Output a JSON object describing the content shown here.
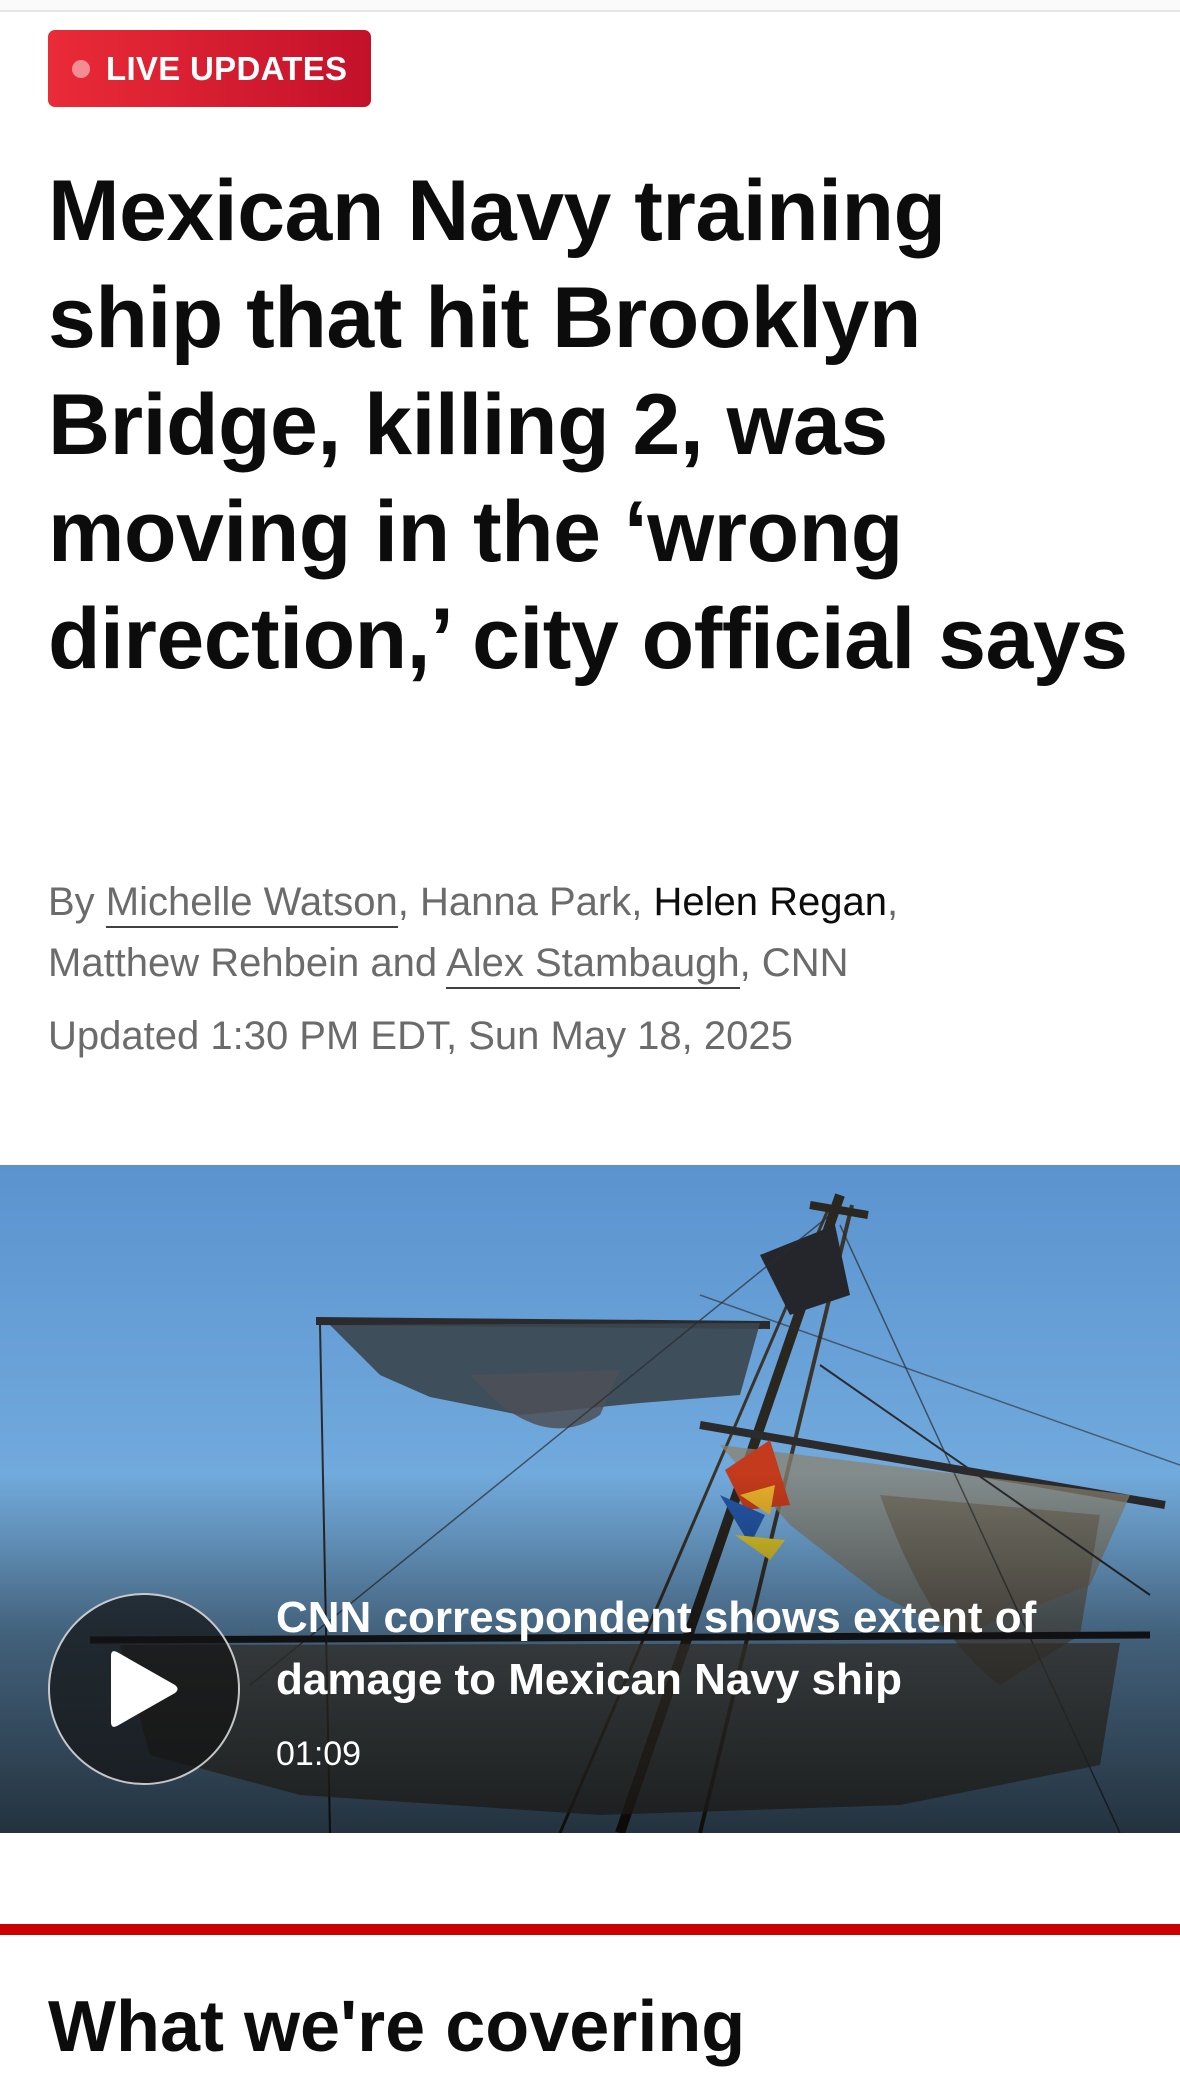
{
  "badge": {
    "label": "LIVE UPDATES",
    "color": "#cc0000"
  },
  "article": {
    "headline": "Mexican Navy training ship that hit Brooklyn Bridge, killing 2, was moving in the ‘wrong direction,’ city official says",
    "byline": {
      "prefix": "By ",
      "authors": [
        "Michelle Watson",
        "Hanna Park",
        "Helen Regan",
        "Matthew Rehbein",
        "Alex Stambaugh"
      ],
      "sep1": ", ",
      "sep2": ", ",
      "sep3": ",",
      "sep4": " and ",
      "suffix": ", CNN"
    },
    "updated": "Updated 1:30 PM EDT, Sun May 18, 2025"
  },
  "video": {
    "title": "CNN correspondent shows extent of damage to Mexican Navy ship",
    "duration": "01:09",
    "play_icon": "play-icon"
  },
  "section": {
    "heading": "What we're covering"
  },
  "colors": {
    "accent": "#cc0000",
    "text": "#0c0c0c",
    "muted": "#6b6b6b"
  }
}
